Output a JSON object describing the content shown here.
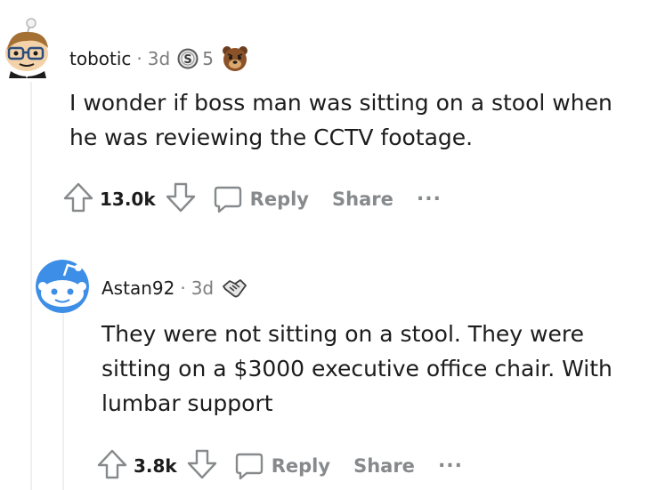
{
  "comments": [
    {
      "username": "tobotic",
      "time": "3d",
      "award_count": "5",
      "body_lines": [
        "I wonder if boss man was sitting on a stool when",
        "he was reviewing the CCTV footage."
      ],
      "score": "13.0k",
      "reply_label": "Reply",
      "share_label": "Share",
      "more_label": "..."
    },
    {
      "username": "Astan92",
      "time": "3d",
      "body_lines": [
        "They were not sitting on a stool. They were",
        "sitting on a $3000 executive office chair. With",
        "lumbar support"
      ],
      "score": "3.8k",
      "reply_label": "Reply",
      "share_label": "Share",
      "more_label": "..."
    }
  ],
  "icons": {
    "upvote": "upvote-arrow-icon",
    "downvote": "downvote-arrow-icon",
    "reply": "speech-bubble-icon",
    "silver_award": "silver-coin-award-icon",
    "bear_award": "bear-award-icon",
    "handshake_award": "handshake-award-icon"
  },
  "colors": {
    "meta_gray": "#7c7c7c",
    "action_gray": "#878a8c",
    "thread_line": "#edeff1",
    "avatar_blue": "#3d8ee6"
  }
}
